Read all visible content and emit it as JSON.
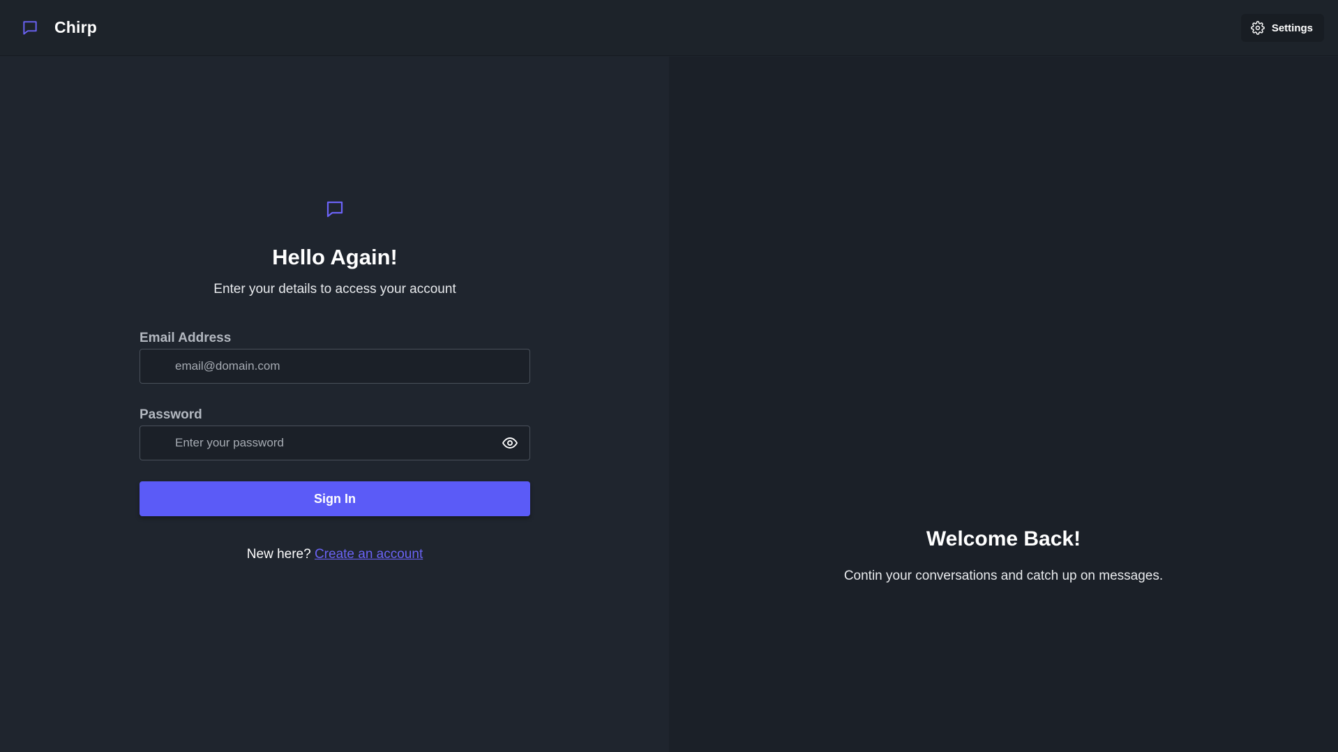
{
  "header": {
    "brand_icon": "chat-bubble-icon",
    "brand_name": "Chirp",
    "settings_icon": "gear-icon",
    "settings_label": "Settings"
  },
  "login": {
    "logo_icon": "chat-bubble-icon",
    "title": "Hello Again!",
    "subtitle": "Enter your details to access your account",
    "email_label": "Email Address",
    "email_placeholder": "email@domain.com",
    "email_value": "",
    "password_label": "Password",
    "password_placeholder": "Enter your password",
    "password_value": "",
    "password_toggle_icon": "eye-icon",
    "signin_label": "Sign In",
    "signup_prompt": "New here? ",
    "signup_link": "Create an account"
  },
  "welcome": {
    "title": "Welcome Back!",
    "text": "Contin your conversations and catch up on messages."
  },
  "colors": {
    "accent": "#5b5bf7",
    "link": "#6a63f5",
    "background_left": "#1f252e",
    "background_right": "#1b2028"
  }
}
